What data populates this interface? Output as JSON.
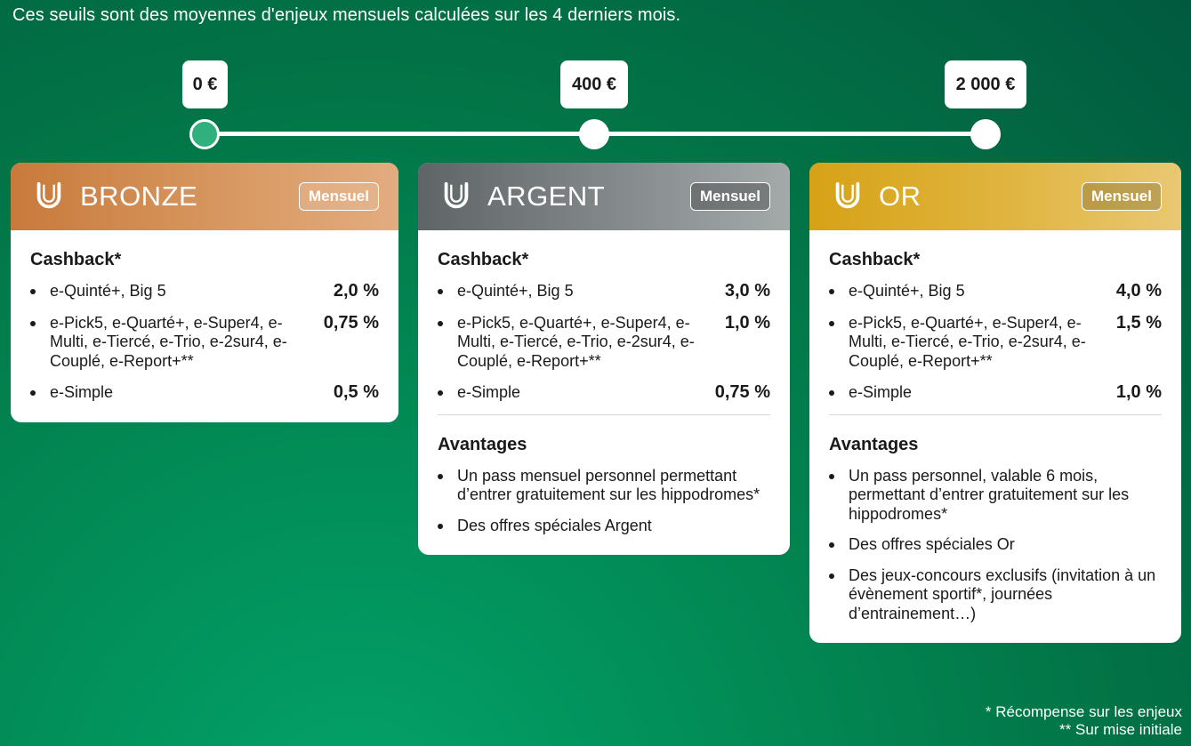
{
  "intro": "Ces seuils sont des moyennes d'enjeux mensuels calculées sur les 4 derniers mois.",
  "thresholds": [
    {
      "label": "0 €"
    },
    {
      "label": "400 €"
    },
    {
      "label": "2 000 €"
    }
  ],
  "tiers": [
    {
      "name": "BRONZE",
      "badge": "Mensuel",
      "cashback_title": "Cashback*",
      "cashback": [
        {
          "label": "e-Quinté+, Big 5",
          "value": "2,0 %"
        },
        {
          "label": "e-Pick5, e-Quarté+, e-Super4, e-Multi, e-Tiercé, e-Trio, e-2sur4, e-Couplé, e-Report+**",
          "value": "0,75 %"
        },
        {
          "label": "e-Simple",
          "value": "0,5 %"
        }
      ]
    },
    {
      "name": "ARGENT",
      "badge": "Mensuel",
      "cashback_title": "Cashback*",
      "cashback": [
        {
          "label": "e-Quinté+, Big 5",
          "value": "3,0 %"
        },
        {
          "label": "e-Pick5, e-Quarté+, e-Super4, e-Multi, e-Tiercé, e-Trio, e-2sur4, e-Couplé, e-Report+**",
          "value": "1,0 %"
        },
        {
          "label": "e-Simple",
          "value": "0,75 %"
        }
      ],
      "advantages_title": "Avantages",
      "advantages": [
        "Un pass mensuel personnel permettant d’entrer gratuitement sur les hippodromes*",
        "Des offres spéciales Argent"
      ]
    },
    {
      "name": "OR",
      "badge": "Mensuel",
      "cashback_title": "Cashback*",
      "cashback": [
        {
          "label": "e-Quinté+, Big 5",
          "value": "4,0 %"
        },
        {
          "label": "e-Pick5, e-Quarté+, e-Super4, e-Multi, e-Tiercé, e-Trio, e-2sur4, e-Couplé, e-Report+**",
          "value": "1,5 %"
        },
        {
          "label": "e-Simple",
          "value": "1,0 %"
        }
      ],
      "advantages_title": "Avantages",
      "advantages": [
        "Un pass personnel, valable 6 mois, permettant d’entrer gratuitement sur les hippodromes*",
        "Des offres spéciales Or",
        "Des jeux-concours exclusifs (invitation à un évènement sportif*, journées d’entrainement…)"
      ]
    }
  ],
  "footnotes": [
    "* Récompense sur les enjeux",
    "** Sur mise initiale"
  ],
  "colors": {
    "bronze": "#c87a3b",
    "argent": "#5f6567",
    "or": "#d6a216",
    "background": "#028a55"
  },
  "icons": {
    "tier": "horseshoe-icon"
  }
}
